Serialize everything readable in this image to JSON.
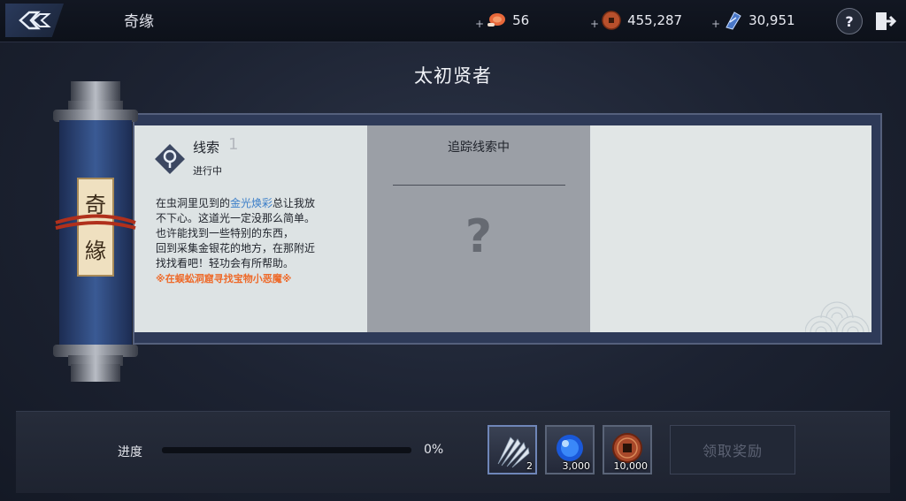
{
  "top_bar": {
    "title": "奇缘",
    "resources": [
      {
        "icon": "meat-icon",
        "value": "56"
      },
      {
        "icon": "copper-coin-icon",
        "value": "455,287"
      },
      {
        "icon": "blue-crystal-icon",
        "value": "30,951"
      }
    ],
    "help_label": "?"
  },
  "page_title": "太初贤者",
  "scroll": {
    "chars": [
      "奇",
      "緣"
    ]
  },
  "clue": {
    "title": "线索",
    "number": "1",
    "status": "进行中",
    "text_lines": [
      {
        "pre": "在虫洞里见到的",
        "hl": "金光焕彩",
        "post": "总让我放"
      },
      {
        "pre": "不下心。这道光一定没那么简单。",
        "hl": "",
        "post": ""
      },
      {
        "pre": "也许能找到一些特别的东西，",
        "hl": "",
        "post": ""
      },
      {
        "pre": "回到采集金银花的地方，在那附近",
        "hl": "",
        "post": ""
      },
      {
        "pre": "找找看吧！轻功会有所帮助。",
        "hl": "",
        "post": ""
      }
    ],
    "hint": "※在蜈蚣洞窟寻找宝物小恶魔※"
  },
  "tracking": {
    "title": "追踪线索中",
    "unknown": "?"
  },
  "progress": {
    "label": "进度",
    "value_text": "0%",
    "fraction": 0
  },
  "rewards": [
    {
      "icon": "feather-icon",
      "count": "2"
    },
    {
      "icon": "blue-orb-icon",
      "count": "3,000"
    },
    {
      "icon": "copper-coin-icon",
      "count": "10,000"
    }
  ],
  "claim_label": "领取奖励",
  "colors": {
    "highlight": "#3b7ec8",
    "hint": "#ee6a2a",
    "panel_frame": "#2e3a58"
  }
}
